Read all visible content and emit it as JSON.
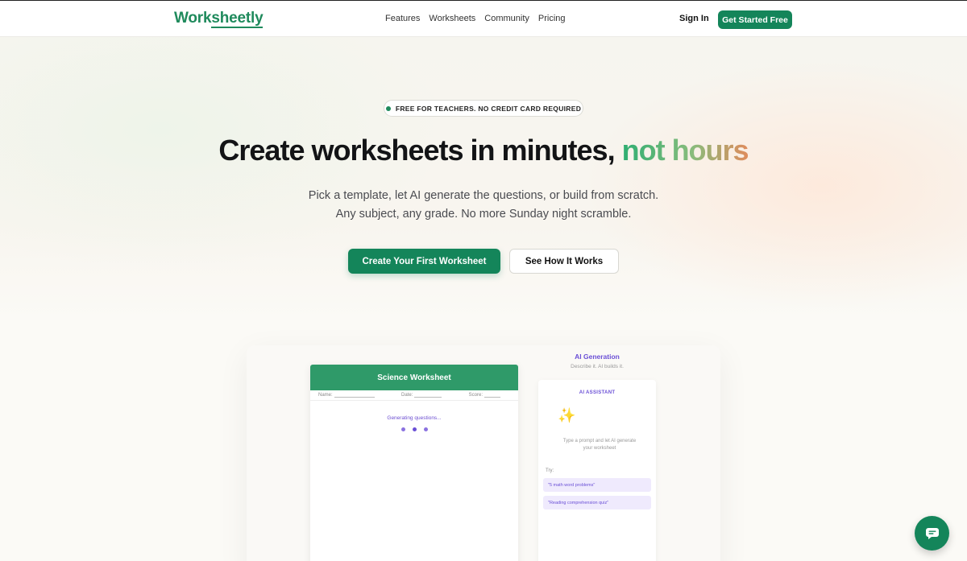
{
  "brand": {
    "logo_prefix": "Work",
    "logo_underlined": "sheetly",
    "accent_color": "#14855a"
  },
  "nav": {
    "links": [
      "Features",
      "Worksheets",
      "Community",
      "Pricing"
    ],
    "sign_in": "Sign In",
    "cta": "Get Started Free"
  },
  "hero": {
    "badge": "FREE FOR TEACHERS. NO CREDIT CARD REQUIRED",
    "headline_main": "Create worksheets in minutes,",
    "headline_accent": "not hours",
    "subtitle": "Pick a template, let AI generate the questions, or build from scratch. Any subject, any grade. No more Sunday night scramble.",
    "primary_button": "Create Your First Worksheet",
    "secondary_button": "See How It Works"
  },
  "preview": {
    "worksheet": {
      "title": "Science Worksheet",
      "name_label": "Name:",
      "date_label": "Date:",
      "score_label": "Score:",
      "status": "Generating questions..."
    },
    "ai": {
      "title": "AI Generation",
      "subtitle": "Describe it. AI builds it.",
      "panel_label": "AI ASSISTANT",
      "prompt_hint": "Type a prompt and let AI generate your worksheet",
      "try_label": "Try:",
      "suggestions": [
        "\"5 math word problems\"",
        "\"Reading comprehension quiz\""
      ]
    }
  },
  "icons": {
    "sparkle": "sparkles-icon",
    "chat": "chat-icon"
  }
}
